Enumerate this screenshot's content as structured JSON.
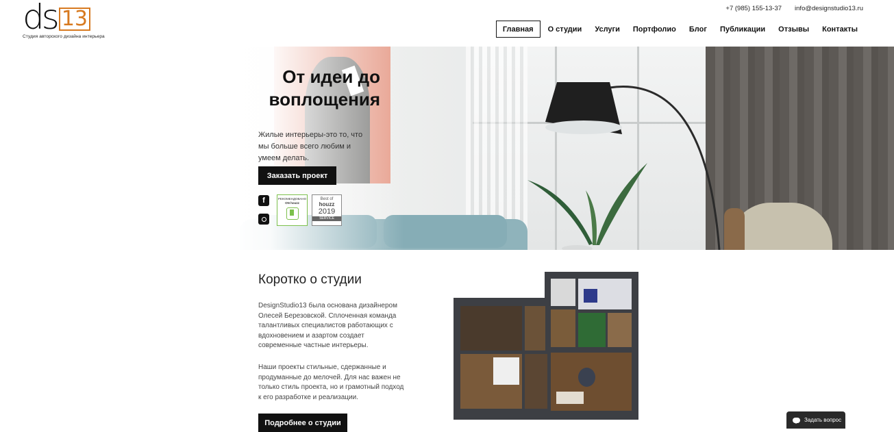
{
  "header": {
    "logo": {
      "text_d": "d",
      "text_s": "s",
      "text_13": "13",
      "subtitle": "Студия авторского дизайна интерьера",
      "accent_color": "#d7791f"
    },
    "phone": "+7 (985) 155-13-37",
    "email": "info@designstudio13.ru",
    "nav": [
      {
        "label": "Главная",
        "active": true
      },
      {
        "label": "О студии",
        "active": false
      },
      {
        "label": "Услуги",
        "active": false
      },
      {
        "label": "Портфолио",
        "active": false
      },
      {
        "label": "Блог",
        "active": false
      },
      {
        "label": "Публикации",
        "active": false
      },
      {
        "label": "Отзывы",
        "active": false
      },
      {
        "label": "Контакты",
        "active": false
      }
    ]
  },
  "hero": {
    "title": "От идеи до воплощения",
    "text": "Жилые интерьеры-это то, что мы больше всего любим и умеем делать.",
    "order_button": "Заказать проект",
    "social": [
      {
        "icon": "facebook-icon",
        "glyph": "f"
      },
      {
        "icon": "instagram-icon",
        "glyph": ""
      }
    ],
    "badge_recommended": {
      "line1": "РЕКОМЕНДОВАНО",
      "line2": "ON houzz"
    },
    "badge_best": {
      "line1": "Best of",
      "line2": "houzz",
      "year": "2019",
      "line4": "SERVICE"
    }
  },
  "about": {
    "title": "Коротко о студии",
    "paragraph1": "DesignStudio13 была основана дизайнером Олесей Березовской. Сплоченная команда талантливых специалистов работающих с вдохновением и азартом создает современные частные интерьеры.",
    "paragraph2": "Наши проекты стильные, сдержанные и продуманные до мелочей. Для нас важен не только стиль проекта, но и грамотный подход к его разработке и реализации.",
    "more_button": "Подробнее о студии"
  },
  "chat": {
    "label": "Задать вопрос"
  }
}
